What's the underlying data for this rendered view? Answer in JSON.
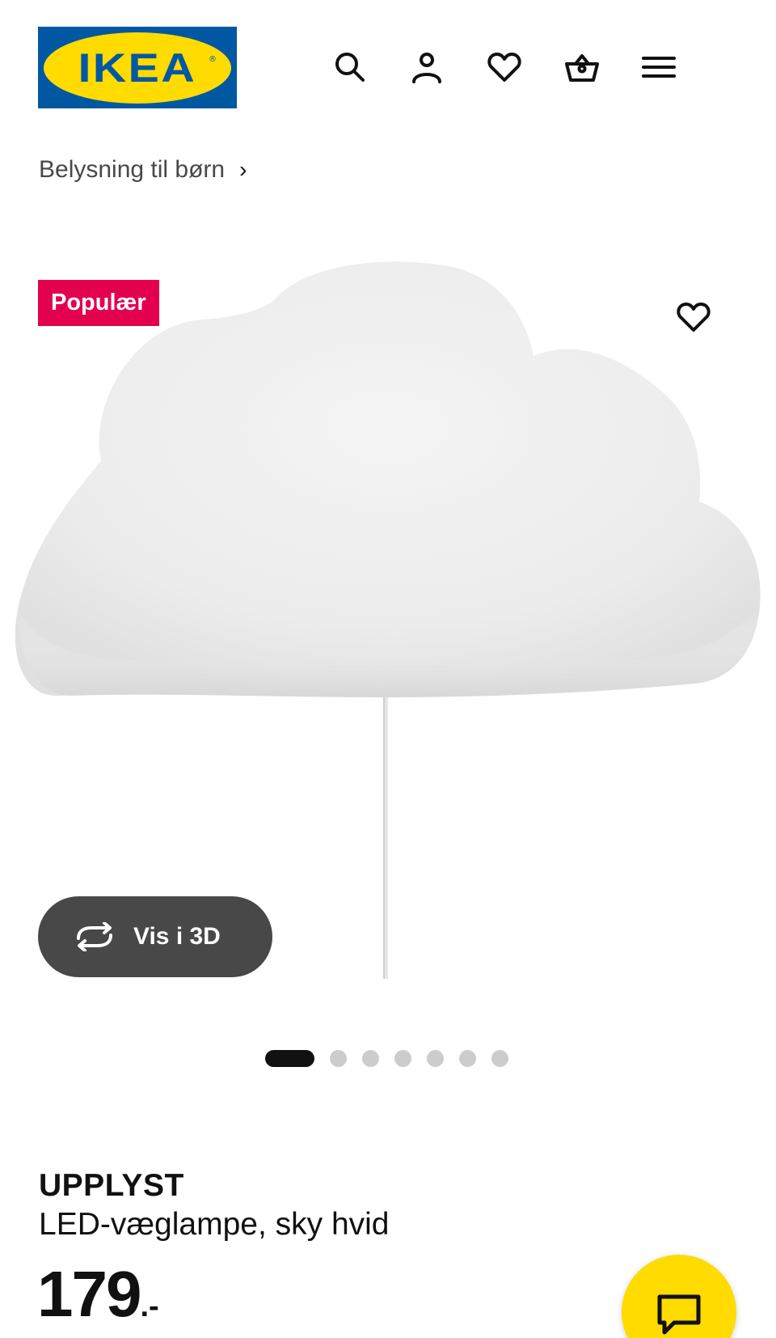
{
  "header": {
    "logo_text": "IKEA",
    "logo_registered": "®",
    "icons": [
      "search-icon",
      "account-icon",
      "heart-icon",
      "shopping-bag-icon",
      "menu-icon"
    ]
  },
  "breadcrumb": {
    "label": "Belysning til børn",
    "chevron": "›"
  },
  "product_image": {
    "badge": "Populær",
    "view_3d_label": "Vis i 3D",
    "carousel": {
      "total": 7,
      "active": 1
    }
  },
  "product": {
    "name": "UPPLYST",
    "description": "LED-væglampe, sky hvid",
    "price": "179",
    "price_suffix": ".-"
  },
  "colors": {
    "ikea_blue": "#0058a3",
    "ikea_yellow": "#ffdb00",
    "badge_red": "#e2004f",
    "button_dark": "#484848"
  }
}
